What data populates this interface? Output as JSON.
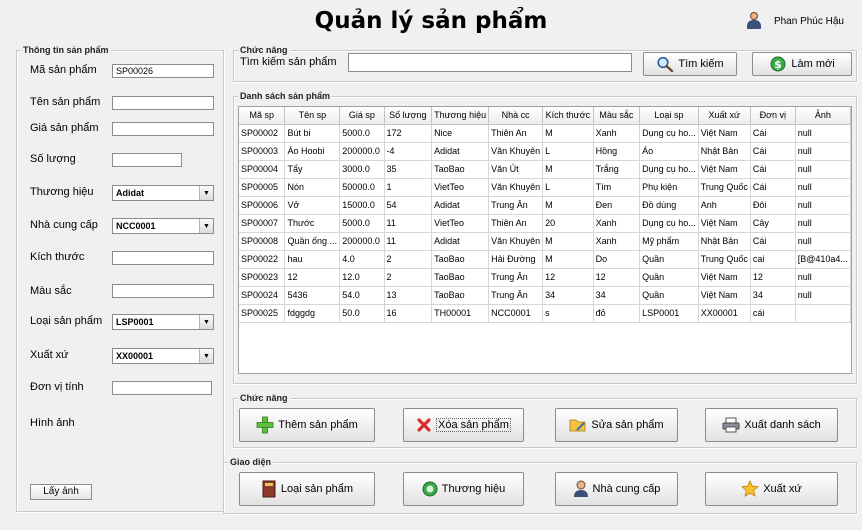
{
  "header": {
    "title": "Quản lý sản phẩm",
    "user_name": "Phan Phúc Hậu"
  },
  "left_panel": {
    "group_title": "Thông tin sản phẩm",
    "fields": {
      "ma": {
        "label": "Mã sản phẩm",
        "value": "SP00026"
      },
      "ten": {
        "label": "Tên sản phẩm",
        "value": ""
      },
      "gia": {
        "label": "Giá sản phẩm",
        "value": ""
      },
      "soluong": {
        "label": "Số lượng",
        "value": ""
      },
      "thuonghieu": {
        "label": "Thương hiệu",
        "value": "Adidat"
      },
      "nhacc": {
        "label": "Nhà cung cấp",
        "value": "NCC0001"
      },
      "kichthuoc": {
        "label": "Kích thước",
        "value": ""
      },
      "mausac": {
        "label": "Màu sắc",
        "value": ""
      },
      "loai": {
        "label": "Loại sản phẩm",
        "value": "LSP0001"
      },
      "xuatxu": {
        "label": "Xuất xứ",
        "value": "XX00001"
      },
      "donvi": {
        "label": "Đơn vị tính",
        "value": ""
      },
      "hinhanh": {
        "label": "Hình ảnh"
      }
    },
    "get_image_label": "Lấy ảnh"
  },
  "search": {
    "group_title": "Chức năng",
    "label": "Tìm kiếm sản phẩm",
    "value": "",
    "search_button": "Tìm kiếm",
    "refresh_button": "Làm mới"
  },
  "table": {
    "group_title": "Danh sách sản phẩm",
    "columns": [
      "Mã sp",
      "Tên sp",
      "Giá sp",
      "Số lượng",
      "Thương hiệu",
      "Nhà cc",
      "Kích thước",
      "Màu sắc",
      "Loại sp",
      "Xuất xứ",
      "Đơn vị",
      "Ảnh"
    ],
    "rows": [
      [
        "SP00002",
        "Bút bi",
        "5000.0",
        "172",
        "Nice",
        "Thiên An",
        "M",
        "Xanh",
        "Dụng cụ ho...",
        "Việt Nam",
        "Cái",
        "null"
      ],
      [
        "SP00003",
        "Áo Hoobi",
        "200000.0",
        "-4",
        "Adidat",
        "Văn Khuyên",
        "L",
        "Hồng",
        "Áo",
        "Nhật Bản",
        "Cái",
        "null"
      ],
      [
        "SP00004",
        "Tẩy",
        "3000.0",
        "35",
        "TaoBao",
        "Văn Út",
        "M",
        "Trắng",
        "Dụng cụ ho...",
        "Việt Nam",
        "Cái",
        "null"
      ],
      [
        "SP00005",
        "Nón",
        "50000.0",
        "1",
        "VietTeo",
        "Văn Khuyên",
        "L",
        "Tím",
        "Phụ kiện",
        "Trung Quốc",
        "Cái",
        "null"
      ],
      [
        "SP00006",
        "Vở",
        "15000.0",
        "54",
        "Adidat",
        "Trung Ân",
        "M",
        "Đen",
        "Đồ dùng",
        "Anh",
        "Đôi",
        "null"
      ],
      [
        "SP00007",
        "Thước",
        "5000.0",
        "11",
        "VietTeo",
        "Thiên An",
        "20",
        "Xanh",
        "Dụng cụ ho...",
        "Việt Nam",
        "Cây",
        "null"
      ],
      [
        "SP00008",
        "Quần ống ...",
        "200000.0",
        "11",
        "Adidat",
        "Văn Khuyên",
        "M",
        "Xanh",
        "Mỹ phẩm",
        "Nhật Bản",
        "Cái",
        "null"
      ],
      [
        "SP00022",
        "hau",
        "4.0",
        "2",
        "TaoBao",
        "Hải Đường",
        "M",
        "Do",
        "Quần",
        "Trung Quốc",
        "cai",
        "[B@410a4..."
      ],
      [
        "SP00023",
        "12",
        "12.0",
        "2",
        "TaoBao",
        "Trung Ân",
        "12",
        "12",
        "Quần",
        "Việt Nam",
        "12",
        "null"
      ],
      [
        "SP00024",
        "5436",
        "54.0",
        "13",
        "TaoBao",
        "Trung Ân",
        "34",
        "34",
        "Quần",
        "Việt Nam",
        "34",
        "null"
      ],
      [
        "SP00025",
        "fdggdg",
        "50.0",
        "16",
        "TH00001",
        "NCC0001",
        "s",
        "đỏ",
        "LSP0001",
        "XX00001",
        "cái",
        ""
      ]
    ]
  },
  "actions": {
    "group_title": "Chức năng",
    "add": "Thêm sản phẩm",
    "delete": "Xóa sản phẩm",
    "edit": "Sửa sản phẩm",
    "export": "Xuất danh sách"
  },
  "nav": {
    "group_title": "Giao diện",
    "category": "Loại sản phẩm",
    "brand": "Thương hiệu",
    "supplier": "Nhà cung cấp",
    "origin": "Xuất xứ"
  }
}
